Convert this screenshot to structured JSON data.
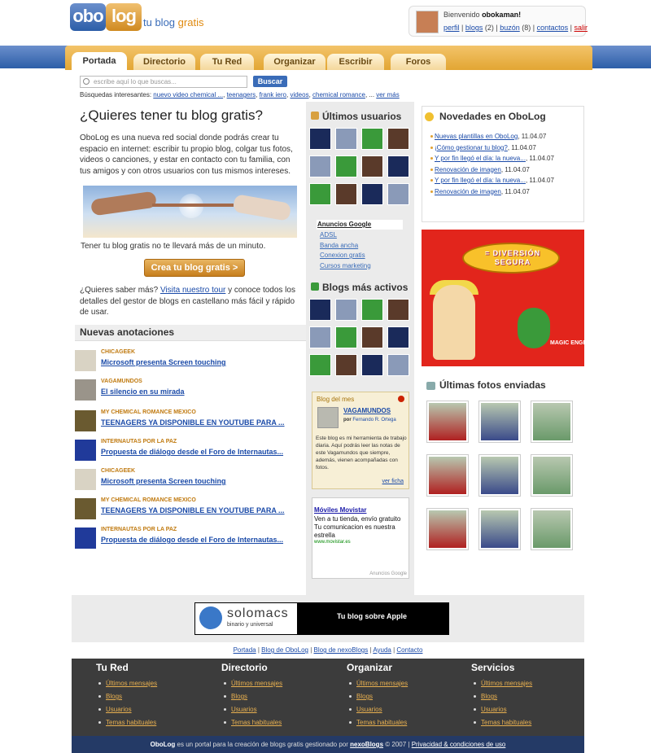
{
  "header": {
    "logo_a": "obo",
    "logo_b": "log",
    "tagline_a": "tu blog",
    "tagline_b": "gratis",
    "welcome_prefix": "Bienvenido",
    "username": "obokaman!",
    "links": {
      "perfil": "perfil",
      "blogs": "blogs",
      "blogs_count": "(2)",
      "buzon": "buzón",
      "buzon_count": "(8)",
      "contactos": "contactos",
      "salir": "salir"
    }
  },
  "nav": {
    "tabs": [
      "Portada",
      "Directorio",
      "Tu Red",
      "Organizar",
      "Escribir",
      "Foros"
    ]
  },
  "search": {
    "placeholder": "escribe aquí lo que buscas...",
    "button": "Buscar",
    "popular_label": "Búsquedas interesantes:",
    "popular": [
      "nuevo video chemical ...",
      "teenagers",
      "frank iero",
      "videos",
      "chemical romance"
    ],
    "more": "ver más"
  },
  "hero": {
    "title": "¿Quieres tener tu blog gratis?",
    "p1": "ObоLog es una nueva red social donde podrás crear tu espacio en internet: escribir tu propio blog, colgar tus fotos, videos o canciones, y estar en contacto con tu familia, con tus amigos y con otros usuarios con tus mismos intereses.",
    "caption": "Tener tu blog gratis no te llevará más de un minuto.",
    "cta": "Crea tu blog gratis >",
    "more_a": "¿Quieres saber más?",
    "more_link": "Visita nuestro tour",
    "more_b": "y conoce todos los detalles del gestor de blogs en castellano más fácil y rápido de usar."
  },
  "notes": {
    "title": "Nuevas anotaciones",
    "items": [
      {
        "author": "CHICAGEEK",
        "title": "Microsoft presenta Screen touching",
        "thumb": "#d9d3c4"
      },
      {
        "author": "VAGAMUNDOS",
        "title": "El silencio en su mirada",
        "thumb": "#9a948a"
      },
      {
        "author": "MY CHEMICAL ROMANCE MEXICO",
        "title": "TEENAGERS YA DISPONIBLE EN YOUTUBE PARA ...",
        "thumb": "#6a5a30"
      },
      {
        "author": "INTERNAUTAS POR LA PAZ",
        "title": "Propuesta de diálogo desde el Foro de Internautas...",
        "thumb": "#203a9a"
      },
      {
        "author": "CHICAGEEK",
        "title": "Microsoft presenta Screen touching",
        "thumb": "#d9d3c4"
      },
      {
        "author": "MY CHEMICAL ROMANCE MEXICO",
        "title": "TEENAGERS YA DISPONIBLE EN YOUTUBE PARA ...",
        "thumb": "#6a5a30"
      },
      {
        "author": "INTERNAUTAS POR LA PAZ",
        "title": "Propuesta de diálogo desde el Foro de Internautas...",
        "thumb": "#203a9a"
      }
    ]
  },
  "middle": {
    "users_title": "Últimos usuarios",
    "ads_title": "Anuncios Google",
    "ads": [
      "ADSL",
      "Banda ancha",
      "Conexion gratis",
      "Cursos marketing"
    ],
    "active_title": "Blogs más activos",
    "botm": {
      "title": "Blog del mes",
      "name": "VAGAMUNDOS",
      "by_prefix": "por",
      "by": "Fernando R. Ortega",
      "desc": "Este blog es mi herramienta de trabajo diaria. Aquí podrás leer las notas de este Vagamundos que siempre, además, vienen acompañadas con fotos.",
      "more": "ver ficha"
    },
    "movistar": {
      "title": "Móviles Movistar",
      "desc": "Ven a tu tienda, envío gratuito Tu comunicacion es nuestra estrella",
      "url": "www.movistar.es",
      "adlabel": "Anuncios Google"
    }
  },
  "news": {
    "title": "Novedades en OboLog",
    "items": [
      {
        "title": "Nuevas plantillas en OboLog",
        "date": "11.04.07"
      },
      {
        "title": "¡Cómo gestionar tu blog?",
        "date": "11.04.07"
      },
      {
        "title": "Y por fin llegó el día: la nueva...",
        "date": "11.04.07"
      },
      {
        "title": "Renovación de imagen",
        "date": "11.04.07"
      },
      {
        "title": "Y por fin llegó el día: la nueva...",
        "date": "11.04.07"
      },
      {
        "title": "Renovación de imagen",
        "date": "11.04.07"
      }
    ]
  },
  "promo": {
    "bubble": "= DIVERSIÓN SEGURA",
    "brand": "MAGIC ENGLISH"
  },
  "photos": {
    "title": "Últimas fotos enviadas"
  },
  "banner": {
    "name": "solomacs",
    "sub": "binario y universal",
    "right": "Tu blog sobre Apple"
  },
  "footer": {
    "links": [
      "Portada",
      "Blog de OboLog",
      "Blog de nexoBlogs",
      "Ayuda",
      "Contacto"
    ],
    "columns": [
      {
        "title": "Tu Red",
        "items": [
          "Últimos mensajes",
          "Blogs",
          "Usuarios",
          "Temas habituales"
        ]
      },
      {
        "title": "Directorio",
        "items": [
          "Últimos mensajes",
          "Blogs",
          "Usuarios",
          "Temas habituales"
        ]
      },
      {
        "title": "Organizar",
        "items": [
          "Últimos mensajes",
          "Blogs",
          "Usuarios",
          "Temas habituales"
        ]
      },
      {
        "title": "Servicios",
        "items": [
          "Últimos mensajes",
          "Blogs",
          "Usuarios",
          "Temas habituales"
        ]
      }
    ],
    "copy_brand": "OboLog",
    "copy_text": "es un portal para la creación de blogs gratis gestionado por",
    "copy_link": "nexoBlogs",
    "copy_year": "© 2007 |",
    "privacy": "Privacidad & condiciones de uso"
  }
}
